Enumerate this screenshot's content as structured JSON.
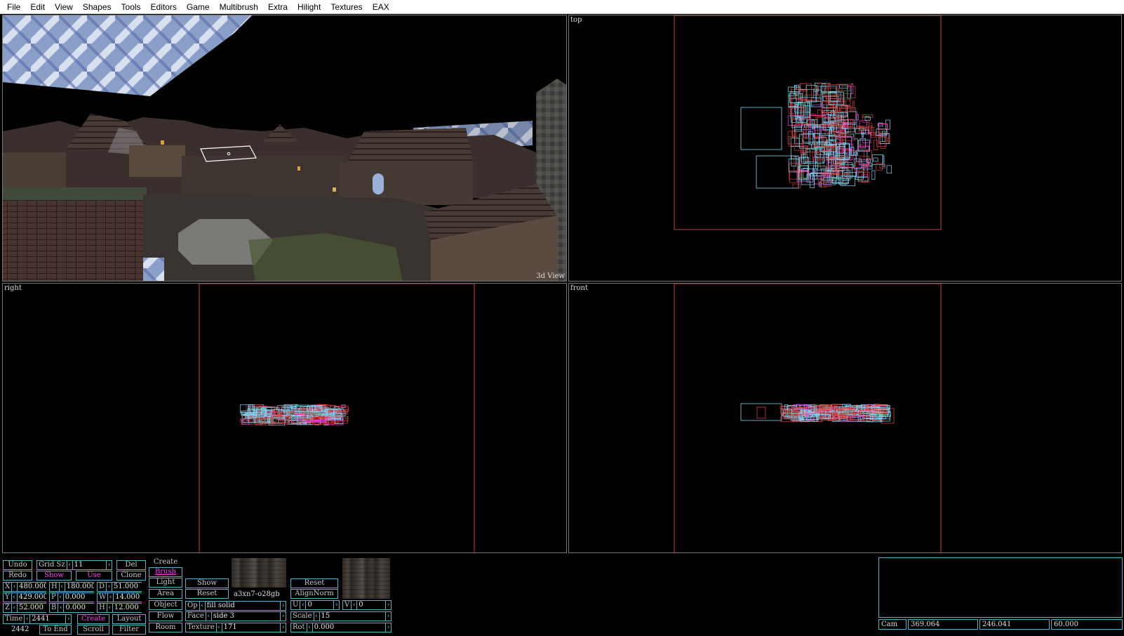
{
  "menu": [
    "File",
    "Edit",
    "View",
    "Shapes",
    "Tools",
    "Editors",
    "Game",
    "Multibrush",
    "Extra",
    "Hilight",
    "Textures",
    "EAX"
  ],
  "viewports": {
    "view3d_label": "3d View",
    "top_label": "top",
    "right_label": "right",
    "front_label": "front"
  },
  "colors": {
    "outline_red": "#d23c3c",
    "brush_cyan": "#7fd6f5",
    "ui_cyan": "#4fb3c7",
    "accent_magenta": "#ff3df0"
  },
  "toolbar": {
    "undo": "Undo",
    "redo": "Redo",
    "grid_sz_label": "Grid Sz",
    "grid_sz_value": "11",
    "show": "Show",
    "use": "Use",
    "del": "Del",
    "clone": "Clone",
    "create": "Create",
    "brush": "Brush",
    "light": "Light",
    "area": "Area",
    "object": "Object",
    "flow": "Flow",
    "room": "Room",
    "show2": "Show",
    "reset": "Reset",
    "create2": "Create",
    "layout": "Layout",
    "to_end": "To End",
    "scroll": "Scroll",
    "filter": "Filter",
    "reset2": "Reset",
    "align_norm": "AlignNorm",
    "texture_name": "a3xn7-o28gb",
    "x": {
      "label": "X",
      "value": "480.000"
    },
    "y": {
      "label": "Y",
      "value": "429.000"
    },
    "z": {
      "label": "Z",
      "value": "52.000"
    },
    "h": {
      "label": "H",
      "value": "180.000"
    },
    "p": {
      "label": "P",
      "value": "0.000"
    },
    "b": {
      "label": "B",
      "value": "0.000"
    },
    "d": {
      "label": "D",
      "value": "51.000"
    },
    "w": {
      "label": "W",
      "value": "14.000"
    },
    "hh": {
      "label": "H",
      "value": "12.000"
    },
    "time": {
      "label": "Time",
      "value": "2441"
    },
    "time_current": "2442",
    "op": {
      "label": "Op",
      "value": "fill solid"
    },
    "face": {
      "label": "Face",
      "value": "side 3"
    },
    "texture": {
      "label": "Texture",
      "value": "171"
    },
    "u": {
      "label": "U",
      "value": "0"
    },
    "v": {
      "label": "V",
      "value": "0"
    },
    "scale": {
      "label": "Scale",
      "value": "15"
    },
    "rot": {
      "label": "Rot",
      "value": "0.000"
    }
  },
  "camera": {
    "label": "Cam",
    "x": "369.064",
    "y": "246.041",
    "z": "60.000"
  }
}
